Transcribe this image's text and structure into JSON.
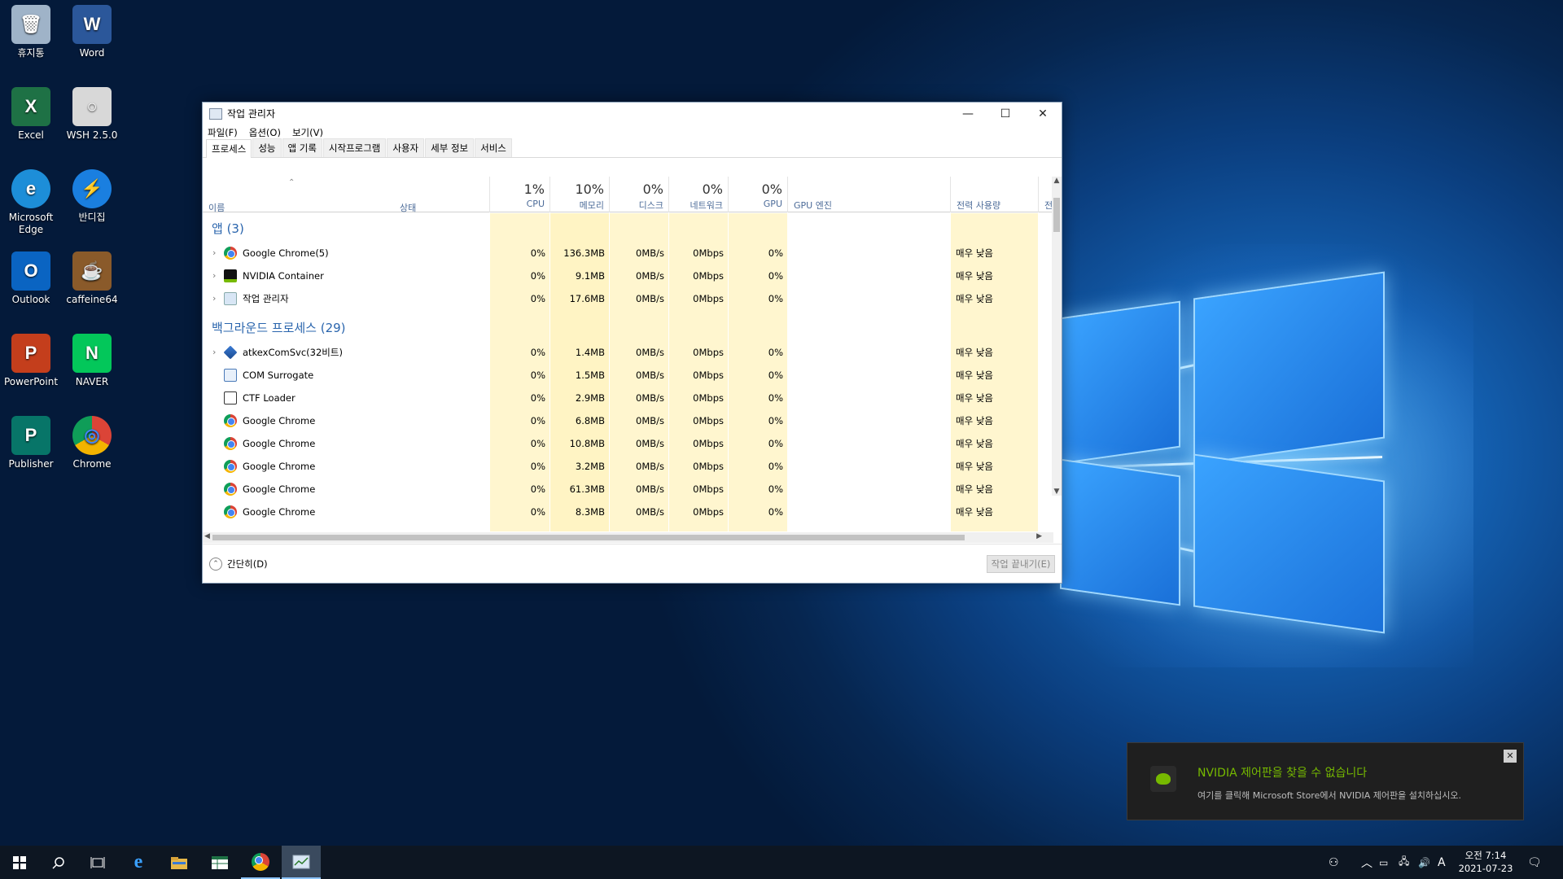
{
  "desktop": {
    "icons": [
      {
        "label": "휴지통",
        "icon": "recycle-bin-icon",
        "color": "#9fb3c8",
        "glyph": "🗑"
      },
      {
        "label": "Word",
        "icon": "word-icon",
        "color": "#2b579a",
        "glyph": "W"
      },
      {
        "label": "Excel",
        "icon": "excel-icon",
        "color": "#1e7145",
        "glyph": "X"
      },
      {
        "label": "WSH 2.5.0",
        "icon": "wsh-icon",
        "color": "#d8d8d8",
        "glyph": "○"
      },
      {
        "label": "Microsoft Edge",
        "icon": "edge-icon",
        "color": "#1d8ed8",
        "glyph": "e"
      },
      {
        "label": "반디집",
        "icon": "bandizip-icon",
        "color": "#1a7fe0",
        "glyph": "⚡"
      },
      {
        "label": "Outlook",
        "icon": "outlook-icon",
        "color": "#0a64c2",
        "glyph": "O"
      },
      {
        "label": "caffeine64",
        "icon": "caffeine-icon",
        "color": "#8a5a2a",
        "glyph": "☕"
      },
      {
        "label": "PowerPoint",
        "icon": "powerpoint-icon",
        "color": "#c43e1c",
        "glyph": "P"
      },
      {
        "label": "NAVER",
        "icon": "naver-icon",
        "color": "#03c75a",
        "glyph": "N"
      },
      {
        "label": "Publisher",
        "icon": "publisher-icon",
        "color": "#077568",
        "glyph": "P"
      },
      {
        "label": "Chrome",
        "icon": "chrome-icon",
        "color": "#ffffff",
        "glyph": "◎"
      }
    ]
  },
  "window": {
    "title": "작업 관리자",
    "menu": [
      "파일(F)",
      "옵션(O)",
      "보기(V)"
    ],
    "tabs": [
      "프로세스",
      "성능",
      "앱 기록",
      "시작프로그램",
      "사용자",
      "세부 정보",
      "서비스"
    ],
    "active_tab": "프로세스"
  },
  "columns": {
    "name": "이름",
    "status": "상태",
    "cpu": {
      "pct": "1%",
      "label": "CPU"
    },
    "memory": {
      "pct": "10%",
      "label": "메모리"
    },
    "disk": {
      "pct": "0%",
      "label": "디스크"
    },
    "network": {
      "pct": "0%",
      "label": "네트워크"
    },
    "gpu": {
      "pct": "0%",
      "label": "GPU"
    },
    "gpu_engine": "GPU 엔진",
    "power": "전력 사용량",
    "power_trend": "전력"
  },
  "groups": {
    "apps": "앱 (3)",
    "background": "백그라운드 프로세스 (29)"
  },
  "apps": [
    {
      "name": "Google Chrome(5)",
      "icon": "chrome",
      "expand": true,
      "cpu": "0%",
      "mem": "136.3MB",
      "disk": "0MB/s",
      "net": "0Mbps",
      "gpu": "0%",
      "power": "매우 낮음"
    },
    {
      "name": "NVIDIA Container",
      "icon": "nvidia",
      "expand": true,
      "cpu": "0%",
      "mem": "9.1MB",
      "disk": "0MB/s",
      "net": "0Mbps",
      "gpu": "0%",
      "power": "매우 낮음"
    },
    {
      "name": "작업 관리자",
      "icon": "taskmgr",
      "expand": true,
      "cpu": "0%",
      "mem": "17.6MB",
      "disk": "0MB/s",
      "net": "0Mbps",
      "gpu": "0%",
      "power": "매우 낮음"
    }
  ],
  "background": [
    {
      "name": "atkexComSvc(32비트)",
      "icon": "atkex",
      "expand": true,
      "cpu": "0%",
      "mem": "1.4MB",
      "disk": "0MB/s",
      "net": "0Mbps",
      "gpu": "0%",
      "power": "매우 낮음"
    },
    {
      "name": "COM Surrogate",
      "icon": "com",
      "expand": false,
      "cpu": "0%",
      "mem": "1.5MB",
      "disk": "0MB/s",
      "net": "0Mbps",
      "gpu": "0%",
      "power": "매우 낮음"
    },
    {
      "name": "CTF Loader",
      "icon": "ctf",
      "expand": false,
      "cpu": "0%",
      "mem": "2.9MB",
      "disk": "0MB/s",
      "net": "0Mbps",
      "gpu": "0%",
      "power": "매우 낮음"
    },
    {
      "name": "Google Chrome",
      "icon": "chrome",
      "expand": false,
      "cpu": "0%",
      "mem": "6.8MB",
      "disk": "0MB/s",
      "net": "0Mbps",
      "gpu": "0%",
      "power": "매우 낮음"
    },
    {
      "name": "Google Chrome",
      "icon": "chrome",
      "expand": false,
      "cpu": "0%",
      "mem": "10.8MB",
      "disk": "0MB/s",
      "net": "0Mbps",
      "gpu": "0%",
      "power": "매우 낮음"
    },
    {
      "name": "Google Chrome",
      "icon": "chrome",
      "expand": false,
      "cpu": "0%",
      "mem": "3.2MB",
      "disk": "0MB/s",
      "net": "0Mbps",
      "gpu": "0%",
      "power": "매우 낮음"
    },
    {
      "name": "Google Chrome",
      "icon": "chrome",
      "expand": false,
      "cpu": "0%",
      "mem": "61.3MB",
      "disk": "0MB/s",
      "net": "0Mbps",
      "gpu": "0%",
      "power": "매우 낮음"
    },
    {
      "name": "Google Chrome",
      "icon": "chrome",
      "expand": false,
      "cpu": "0%",
      "mem": "8.3MB",
      "disk": "0MB/s",
      "net": "0Mbps",
      "gpu": "0%",
      "power": "매우 낮음"
    }
  ],
  "footer": {
    "less_details": "간단히(D)",
    "end_task": "작업 끝내기(E)"
  },
  "toast": {
    "title": "NVIDIA 제어판을 찾을 수 없습니다",
    "body": "여기를 클릭해 Microsoft Store에서 NVIDIA 제어판을 설치하십시오."
  },
  "taskbar": {
    "ime": "A",
    "time": "오전 7:14",
    "date": "2021-07-23"
  },
  "colors": {
    "accent": "#2a65ad",
    "highlight": "#fff4c4",
    "nvidia_green": "#76b900"
  }
}
